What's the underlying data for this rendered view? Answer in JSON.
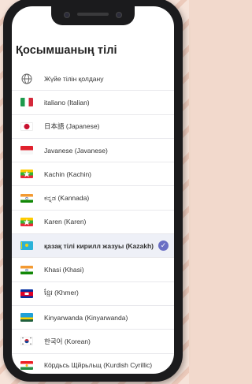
{
  "page": {
    "title": "Қосымшаның тілі"
  },
  "languages": [
    {
      "label": "Жүйе тілін қолдану",
      "flag": "globe-icon",
      "selected": false
    },
    {
      "label": "italiano (Italian)",
      "flag": "italy",
      "selected": false
    },
    {
      "label": "日本語 (Japanese)",
      "flag": "japan",
      "selected": false
    },
    {
      "label": "Javanese (Javanese)",
      "flag": "indonesia",
      "selected": false
    },
    {
      "label": "Kachin (Kachin)",
      "flag": "myanmar",
      "selected": false
    },
    {
      "label": "ಕನ್ನಡ (Kannada)",
      "flag": "india",
      "selected": false
    },
    {
      "label": "Karen (Karen)",
      "flag": "myanmar",
      "selected": false
    },
    {
      "label": "қазақ тілі кирилл жазуы (Kazakh)",
      "flag": "kazakhstan",
      "selected": true
    },
    {
      "label": "Khasi (Khasi)",
      "flag": "india",
      "selected": false
    },
    {
      "label": "ខ្មែរ (Khmer)",
      "flag": "cambodia",
      "selected": false
    },
    {
      "label": "Kinyarwanda (Kinyarwanda)",
      "flag": "rwanda",
      "selected": false
    },
    {
      "label": "한국어 (Korean)",
      "flag": "south-korea",
      "selected": false
    },
    {
      "label": "Кӧрдьсь Щйрьльщ (Kurdish Cyrillic)",
      "flag": "kurdistan",
      "selected": false
    }
  ],
  "colors": {
    "accent": "#6a6fc4",
    "divider": "#e8e8ec"
  }
}
